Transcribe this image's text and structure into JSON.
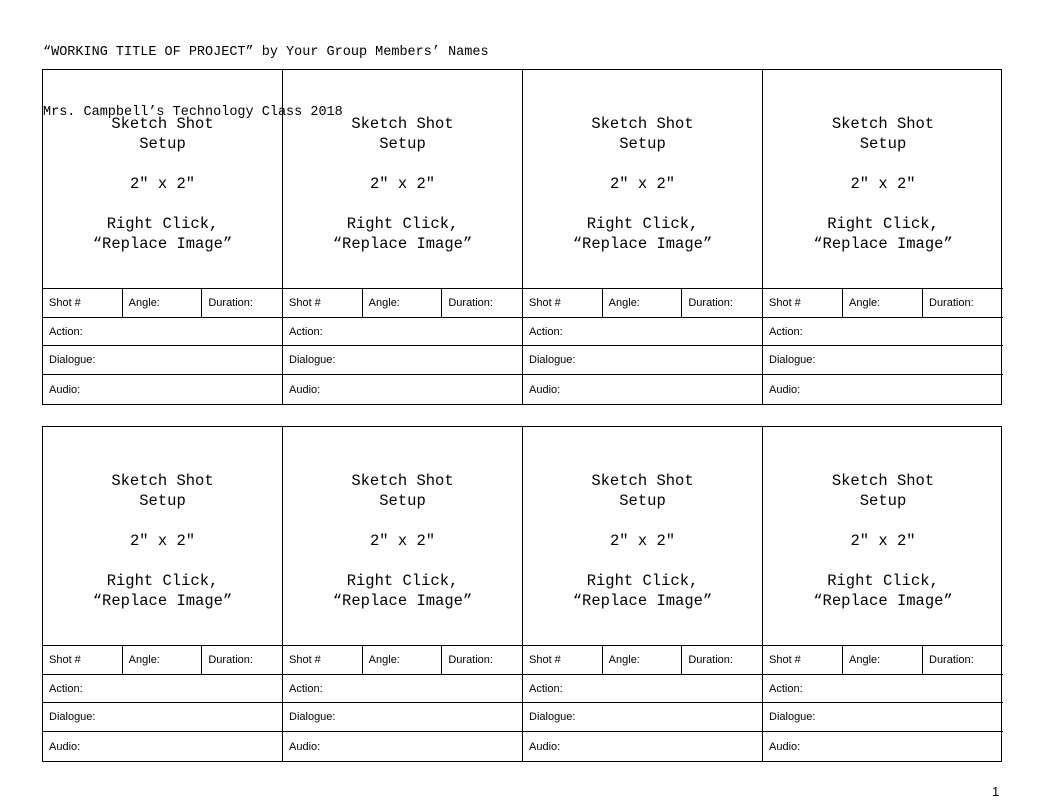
{
  "header": {
    "line1": "“WORKING TITLE OF PROJECT” by Your Group Members’ Names",
    "line2": "Mrs. Campbell’s Technology Class 2018"
  },
  "cell": {
    "sketch_line1": "Sketch Shot",
    "sketch_line2": "Setup",
    "size": "2″ x 2″",
    "instruction_line1": "Right Click,",
    "instruction_line2": "“Replace Image”",
    "shot_label": "Shot #",
    "angle_label": "Angle:",
    "duration_label": "Duration:",
    "action_label": "Action:",
    "dialogue_label": "Dialogue:",
    "audio_label": "Audio:"
  },
  "blocks": 2,
  "cells_per_block": 4,
  "page_number": "1"
}
